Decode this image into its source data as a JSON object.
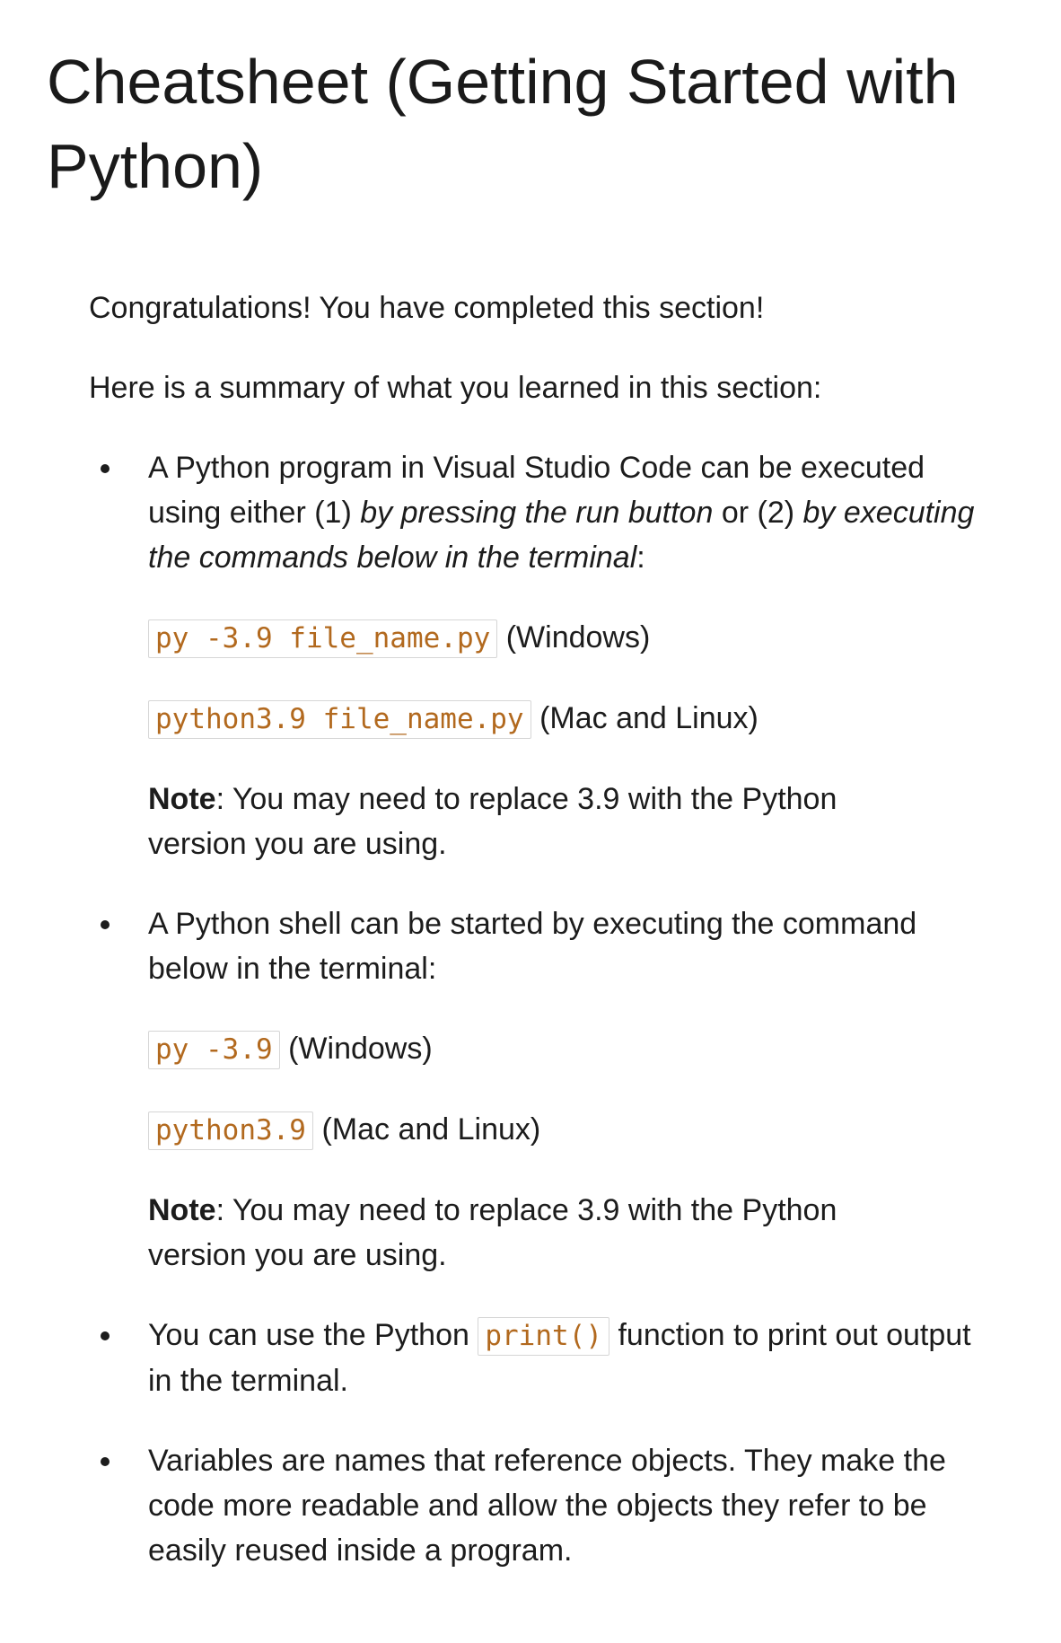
{
  "title": "Cheatsheet (Getting Started with Python)",
  "intro": "Congratulations! You have completed this section!",
  "summary_intro": "Here is a summary of what you learned in this section:",
  "items": [
    {
      "text_before": "A Python program in Visual Studio Code can be executed using either (1) ",
      "emphasis_1": "by pressing the run button",
      "text_middle": " or (2) ",
      "emphasis_2": "by executing the commands below in the terminal",
      "text_after": ":",
      "commands": [
        {
          "code": "py -3.9 file_name.py",
          "platform": "(Windows)"
        },
        {
          "code": "python3.9 file_name.py",
          "platform": "(Mac and Linux)"
        }
      ],
      "note_label": "Note",
      "note_text": ": You may need to replace 3.9 with the Python version you are using."
    },
    {
      "text": "A Python shell can be started by executing the command below in the terminal:",
      "commands": [
        {
          "code": "py -3.9",
          "platform": "(Windows)"
        },
        {
          "code": "python3.9",
          "platform": "(Mac and Linux)"
        }
      ],
      "note_label": "Note",
      "note_text": ": You may need to replace 3.9 with the Python version you are using."
    },
    {
      "text_before": "You can use the Python ",
      "code": "print()",
      "text_after": " function to print out output in the terminal."
    },
    {
      "text": "Variables are names that reference objects. They make the code more readable and allow the objects they refer to be easily reused inside a program."
    }
  ]
}
